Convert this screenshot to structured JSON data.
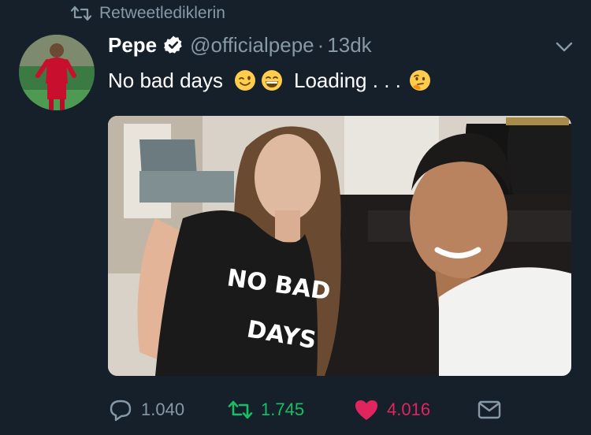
{
  "retweet_context": {
    "label": "Retweetlediklerin"
  },
  "tweet": {
    "author_name": "Pepe",
    "handle": "@officialpepe",
    "separator": "·",
    "timestamp": "13dk",
    "text_part1": "No bad days",
    "text_part2": "Loading . . .",
    "emojis": [
      "winking-face",
      "grinning-face",
      "thinking-face"
    ],
    "media": {
      "shirt_text_line1": "NO BAD",
      "shirt_text_line2": "DAYS"
    }
  },
  "actions": {
    "reply_count": "1.040",
    "retweet_count": "1.745",
    "like_count": "4.016"
  },
  "colors": {
    "background": "#15202b",
    "secondary_text": "#8899a6",
    "retweet_active": "#17bf63",
    "like_active": "#e0245e",
    "verified": "#ffffff"
  }
}
